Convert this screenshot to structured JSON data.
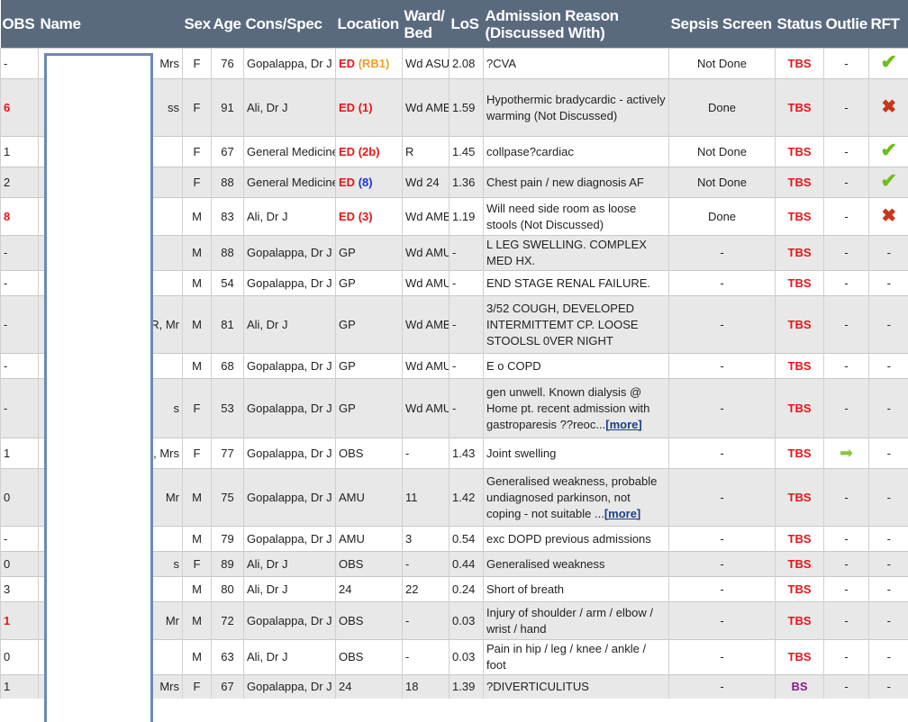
{
  "headers": {
    "obs": "OBS",
    "name": "Name",
    "sex": "Sex",
    "age": "Age",
    "cons": "Cons/Spec",
    "location": "Location",
    "ward": "Ward/ Bed",
    "los": "LoS",
    "reason": "Admission Reason (Discussed With)",
    "sepsis": "Sepsis Screen",
    "status": "Status",
    "outlie": "Outlie",
    "rft": "RFT"
  },
  "more_label": "[more]",
  "rows": [
    {
      "obs": "-",
      "name": "Mrs",
      "sex": "F",
      "age": "76",
      "cons": "Gopalappa, Dr J",
      "loc_main": "ED",
      "loc_sub": "(RB1)",
      "loc_sub_color": "orange",
      "ward": "Wd ASU",
      "los": "2.08",
      "reason": "?CVA",
      "more": false,
      "sepsis": "Not Done",
      "status": "TBS",
      "outlie": "-",
      "rft": "tick"
    },
    {
      "obs": "6",
      "obs_red": true,
      "name": "ss",
      "sex": "F",
      "age": "91",
      "cons": "Ali, Dr J",
      "loc_main": "ED",
      "loc_sub": "(1)",
      "loc_sub_color": "red",
      "ward": "Wd AMB",
      "los": "1.59",
      "reason": "Hypothermic bradycardic - actively warming (Not Discussed)",
      "more": false,
      "sepsis": "Done",
      "status": "TBS",
      "outlie": "-",
      "rft": "cross"
    },
    {
      "obs": "1",
      "name": "",
      "sex": "F",
      "age": "67",
      "cons": "General Medicine",
      "loc_main": "ED",
      "loc_sub": "(2b)",
      "loc_sub_color": "red",
      "ward": "R",
      "los": "1.45",
      "reason": "collpase?cardiac",
      "more": false,
      "sepsis": "Not Done",
      "status": "TBS",
      "outlie": "-",
      "rft": "tick"
    },
    {
      "obs": "2",
      "name": "",
      "sex": "F",
      "age": "88",
      "cons": "General Medicine",
      "loc_main": "ED",
      "loc_sub": "(8)",
      "loc_sub_color": "blue",
      "ward": "Wd 24",
      "los": "1.36",
      "reason": "Chest pain / new diagnosis AF",
      "more": false,
      "sepsis": "Not Done",
      "status": "TBS",
      "outlie": "-",
      "rft": "tick"
    },
    {
      "obs": "8",
      "obs_red": true,
      "name": "",
      "sex": "M",
      "age": "83",
      "cons": "Ali, Dr J",
      "loc_main": "ED",
      "loc_sub": "(3)",
      "loc_sub_color": "red",
      "ward": "Wd AMB",
      "los": "1.19",
      "reason": "Will need side room as loose stools (Not Discussed)",
      "more": false,
      "sepsis": "Done",
      "status": "TBS",
      "outlie": "-",
      "rft": "cross"
    },
    {
      "obs": "-",
      "name": "",
      "sex": "M",
      "age": "88",
      "cons": "Gopalappa, Dr J",
      "loc_main": "GP",
      "loc_sub": "",
      "loc_sub_color": "",
      "ward": "Wd AMU",
      "los": "-",
      "reason": "L LEG SWELLING. COMPLEX MED HX.",
      "more": false,
      "sepsis": "-",
      "status": "TBS",
      "outlie": "-",
      "rft": "-"
    },
    {
      "obs": "-",
      "name": "",
      "sex": "M",
      "age": "54",
      "cons": "Gopalappa, Dr J",
      "loc_main": "GP",
      "loc_sub": "",
      "loc_sub_color": "",
      "ward": "Wd AMU",
      "los": "-",
      "reason": "END STAGE RENAL FAILURE.",
      "more": false,
      "sepsis": "-",
      "status": "TBS",
      "outlie": "-",
      "rft": "-"
    },
    {
      "obs": "-",
      "name": "R, Mr",
      "sex": "M",
      "age": "81",
      "cons": "Ali, Dr J",
      "loc_main": "GP",
      "loc_sub": "",
      "loc_sub_color": "",
      "ward": "Wd AMB",
      "los": "-",
      "reason": "3/52 COUGH, DEVELOPED INTERMITTEMT CP. LOOSE STOOLSL 0VER NIGHT",
      "more": false,
      "sepsis": "-",
      "status": "TBS",
      "outlie": "-",
      "rft": "-"
    },
    {
      "obs": "-",
      "name": "",
      "sex": "M",
      "age": "68",
      "cons": "Gopalappa, Dr J",
      "loc_main": "GP",
      "loc_sub": "",
      "loc_sub_color": "",
      "ward": "Wd AMU",
      "los": "-",
      "reason": "E o COPD",
      "more": false,
      "sepsis": "-",
      "status": "TBS",
      "outlie": "-",
      "rft": "-"
    },
    {
      "obs": "-",
      "name": "s",
      "sex": "F",
      "age": "53",
      "cons": "Gopalappa, Dr J",
      "loc_main": "GP",
      "loc_sub": "",
      "loc_sub_color": "",
      "ward": "Wd AMU",
      "los": "-",
      "reason": "gen unwell. Known dialysis @ Home pt. recent admission with gastroparesis ??reoc...",
      "more": true,
      "sepsis": "-",
      "status": "TBS",
      "outlie": "-",
      "rft": "-"
    },
    {
      "obs": "1",
      "name": "G, Mrs",
      "sex": "F",
      "age": "77",
      "cons": "Gopalappa, Dr J",
      "loc_main": "OBS",
      "loc_sub": "",
      "loc_sub_color": "",
      "ward": "-",
      "los": "1.43",
      "reason": "Joint swelling",
      "more": false,
      "sepsis": "-",
      "status": "TBS",
      "outlie": "arrow",
      "rft": "-"
    },
    {
      "obs": "0",
      "name": "Mr",
      "sex": "M",
      "age": "75",
      "cons": "Gopalappa, Dr J",
      "loc_main": "AMU",
      "loc_sub": "",
      "loc_sub_color": "",
      "ward": "11",
      "los": "1.42",
      "reason": "Generalised weakness, probable undiagnosed parkinson, not coping - not suitable ...",
      "more": true,
      "sepsis": "-",
      "status": "TBS",
      "outlie": "-",
      "rft": "-"
    },
    {
      "obs": "-",
      "name": "",
      "sex": "M",
      "age": "79",
      "cons": "Gopalappa, Dr J",
      "loc_main": "AMU",
      "loc_sub": "",
      "loc_sub_color": "",
      "ward": "3",
      "los": "0.54",
      "reason": "exc DOPD previous admissions",
      "more": false,
      "sepsis": "-",
      "status": "TBS",
      "outlie": "-",
      "rft": "-"
    },
    {
      "obs": "0",
      "name": "s",
      "sex": "F",
      "age": "89",
      "cons": "Ali, Dr J",
      "loc_main": "OBS",
      "loc_sub": "",
      "loc_sub_color": "",
      "ward": "-",
      "los": "0.44",
      "reason": "Generalised weakness",
      "more": false,
      "sepsis": "-",
      "status": "TBS",
      "outlie": "-",
      "rft": "-"
    },
    {
      "obs": "3",
      "name": "",
      "sex": "M",
      "age": "80",
      "cons": "Ali, Dr J",
      "loc_main": "24",
      "loc_sub": "",
      "loc_sub_color": "",
      "ward": "22",
      "los": "0.24",
      "reason": "Short of breath",
      "more": false,
      "sepsis": "-",
      "status": "TBS",
      "outlie": "-",
      "rft": "-"
    },
    {
      "obs": "1",
      "obs_red": true,
      "name": "Mr",
      "sex": "M",
      "age": "72",
      "cons": "Gopalappa, Dr J",
      "loc_main": "OBS",
      "loc_sub": "",
      "loc_sub_color": "",
      "ward": "-",
      "los": "0.03",
      "reason": "Injury of shoulder / arm / elbow / wrist / hand",
      "more": false,
      "sepsis": "-",
      "status": "TBS",
      "outlie": "-",
      "rft": "-"
    },
    {
      "obs": "0",
      "name": "",
      "sex": "M",
      "age": "63",
      "cons": "Ali, Dr J",
      "loc_main": "OBS",
      "loc_sub": "",
      "loc_sub_color": "",
      "ward": "-",
      "los": "0.03",
      "reason": "Pain in hip / leg / knee / ankle / foot",
      "more": false,
      "sepsis": "-",
      "status": "TBS",
      "outlie": "-",
      "rft": "-"
    },
    {
      "obs": "1",
      "name": "Mrs",
      "sex": "F",
      "age": "67",
      "cons": "Gopalappa, Dr J",
      "loc_main": "24",
      "loc_sub": "",
      "loc_sub_color": "",
      "ward": "18",
      "los": "1.39",
      "reason": "?DIVERTICULITUS",
      "more": false,
      "sepsis": "-",
      "status": "BS",
      "outlie": "-",
      "rft": "-"
    }
  ]
}
